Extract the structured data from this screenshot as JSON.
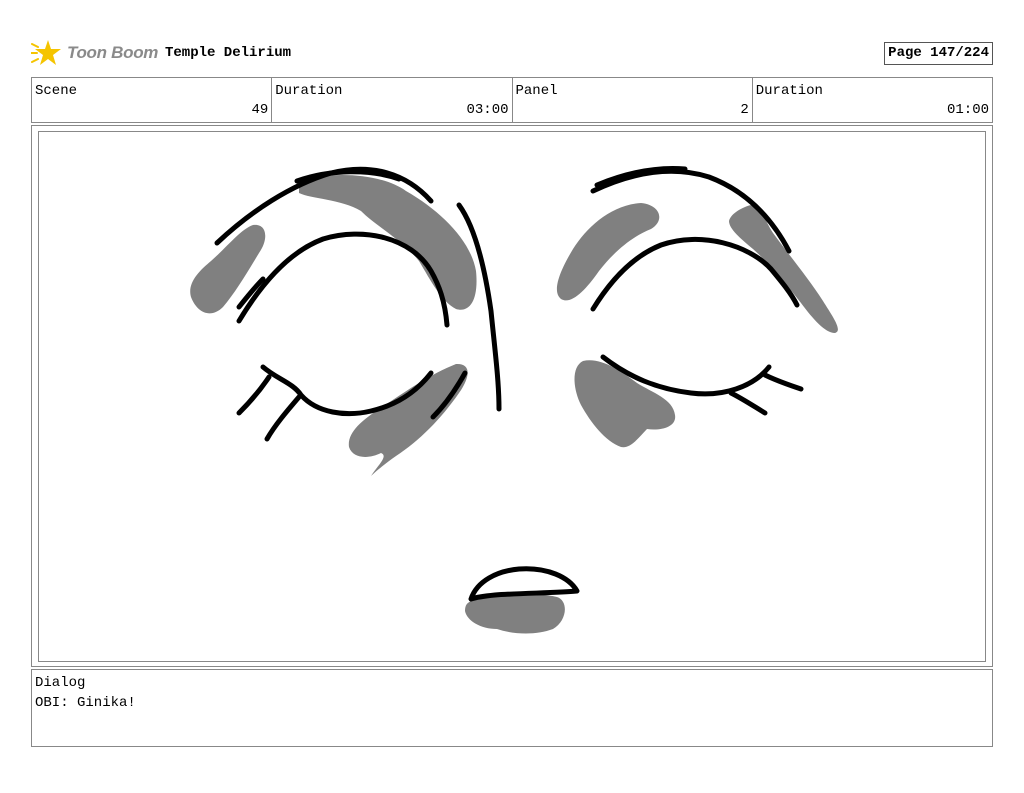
{
  "header": {
    "logo_text": "Toon Boom",
    "project_title": "Temple Delirium",
    "page_label": "Page 147/224"
  },
  "info": {
    "scene_label": "Scene",
    "scene_value": "49",
    "scene_duration_label": "Duration",
    "scene_duration_value": "03:00",
    "panel_label": "Panel",
    "panel_value": "2",
    "panel_duration_label": "Duration",
    "panel_duration_value": "01:00"
  },
  "dialog": {
    "label": "Dialog",
    "text": "OBI: Ginika!"
  },
  "colors": {
    "line": "#000000",
    "shadow": "#808080",
    "border": "#888888",
    "logo_star": "#f5c400",
    "logo_text": "#8a8a8a"
  },
  "icons": {
    "logo": "toon-boom-star-icon"
  }
}
